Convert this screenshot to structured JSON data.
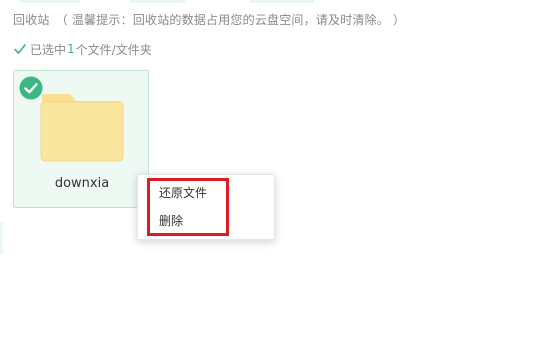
{
  "header": {
    "title": "回收站",
    "tip": "（ 温馨提示：回收站的数据占用您的云盘空间，请及时清除。 ）"
  },
  "selection": {
    "prefix": "已选中",
    "count": "1",
    "suffix": "个文件/文件夹"
  },
  "files": [
    {
      "name": "downxia",
      "icon": "folder-icon",
      "selected": true
    }
  ],
  "context_menu": {
    "items": [
      {
        "label": "还原文件"
      },
      {
        "label": "删除"
      }
    ]
  },
  "colors": {
    "accent": "#3bb783",
    "card_background": "#eef9f4",
    "card_border": "#bfe5d3",
    "folder": "#fbe6a0",
    "annotation_border": "#e01b24"
  }
}
